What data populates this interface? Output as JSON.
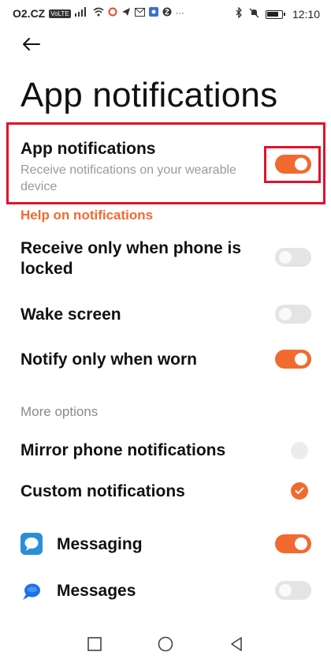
{
  "status": {
    "carrier": "O2.CZ",
    "volte": "VoLTE",
    "signal": "4G",
    "time": "12:10"
  },
  "page": {
    "title": "App notifications"
  },
  "master": {
    "title": "App notifications",
    "subtitle_line1": "Receive notifications on your wearable",
    "subtitle_line2": "device",
    "enabled": true
  },
  "help_link": "Help on notifications",
  "settings": [
    {
      "line1": "Receive only when phone is",
      "line2": "locked",
      "enabled": false
    },
    {
      "label": "Wake screen",
      "enabled": false
    },
    {
      "label": "Notify only when worn",
      "enabled": true
    }
  ],
  "more_options": {
    "label": "More options",
    "mirror_label": "Mirror phone notifications",
    "mirror_checked": false,
    "custom_label": "Custom notifications",
    "custom_checked": true
  },
  "apps": [
    {
      "name": "Messaging",
      "icon": "messaging-app-icon",
      "enabled": true
    },
    {
      "name": "Messages",
      "icon": "messages-app-icon",
      "enabled": false
    }
  ],
  "colors": {
    "accent": "#f26a30",
    "highlight": "#e0122a",
    "toggle_off": "#e4e4e4"
  },
  "nav": [
    "recents-square-icon",
    "home-circle-icon",
    "back-triangle-icon"
  ]
}
